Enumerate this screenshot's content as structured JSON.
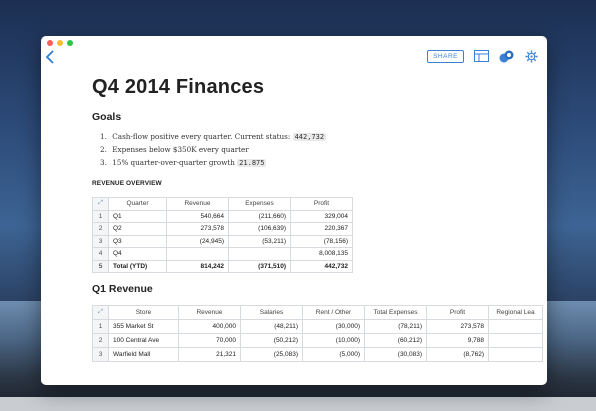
{
  "colors": {
    "accent": "#3b82d6",
    "close": "#ff5f57",
    "minimize": "#febc2e",
    "zoom": "#28c840"
  },
  "toolbar": {
    "share_label": "SHARE",
    "icons": [
      "back-chevron-icon",
      "layout-icon",
      "collaborators-icon",
      "settings-gear-icon"
    ]
  },
  "doc": {
    "title": "Q4 2014 Finances",
    "goals_heading": "Goals",
    "goals": [
      {
        "num": "1.",
        "text": "Cash-flow positive every quarter. Current status:",
        "badge": "442,732"
      },
      {
        "num": "2.",
        "text": "Expenses below $350K every quarter",
        "badge": ""
      },
      {
        "num": "3.",
        "text": "15% quarter-over-quarter growth",
        "badge": "21.875"
      }
    ],
    "overview_heading": "REVENUE OVERVIEW",
    "q1_heading": "Q1 Revenue"
  },
  "overview": {
    "headers": [
      "Quarter",
      "Revenue",
      "Expenses",
      "Profit"
    ],
    "rows": [
      [
        "1",
        "Q1",
        "540,664",
        "(211,660)",
        "329,004"
      ],
      [
        "2",
        "Q2",
        "273,578",
        "(106,639)",
        "220,367"
      ],
      [
        "3",
        "Q3",
        "(24,945)",
        "(53,211)",
        "(78,156)"
      ],
      [
        "4",
        "Q4",
        "",
        "",
        "8,008,135"
      ],
      [
        "5",
        "Total (YTD)",
        "814,242",
        "(371,510)",
        "442,732"
      ]
    ]
  },
  "q1": {
    "headers": [
      "Store",
      "Revenue",
      "Salaries",
      "Rent / Other",
      "Total Expenses",
      "Profit",
      "Regional Lea"
    ],
    "rows": [
      [
        "1",
        "355 Market St",
        "400,000",
        "(48,211)",
        "(30,000)",
        "(78,211)",
        "273,578",
        ""
      ],
      [
        "2",
        "100 Central Ave",
        "70,000",
        "(50,212)",
        "(10,000)",
        "(60,212)",
        "9,788",
        ""
      ],
      [
        "3",
        "Warfield Mall",
        "21,321",
        "(25,083)",
        "(5,000)",
        "(30,083)",
        "(8,762)",
        ""
      ]
    ]
  }
}
